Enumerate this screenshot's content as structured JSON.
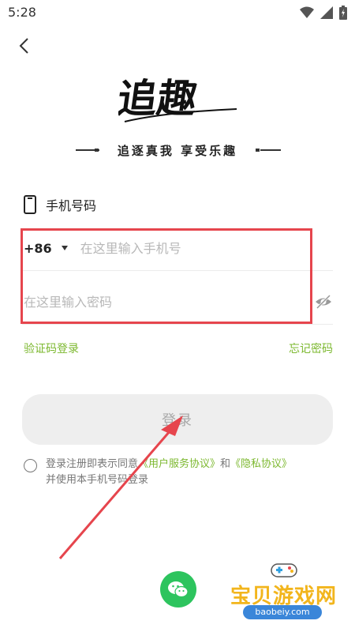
{
  "status_bar": {
    "time": "5:28"
  },
  "brand": {
    "logo_text": "追趣",
    "slogan": "追逐真我 享受乐趣"
  },
  "login_form": {
    "phone_label": "手机号码",
    "country_code": "+86",
    "phone_placeholder": "在这里输入手机号",
    "password_placeholder": "在这里输入密码"
  },
  "links": {
    "sms_login": "验证码登录",
    "forgot_password": "忘记密码"
  },
  "login_button": "登录",
  "agreement": {
    "prefix": "登录注册即表示同意",
    "user_agreement": "《用户服务协议》",
    "and": "和",
    "privacy_policy": "《隐私协议》",
    "suffix": "并使用本手机号码登录"
  },
  "watermark": {
    "title": "宝贝游戏网",
    "url": "baobeiy.com"
  },
  "colors": {
    "accent_green": "#7cb82f",
    "highlight_red": "#e6454d",
    "wechat_green": "#2dc45e"
  }
}
